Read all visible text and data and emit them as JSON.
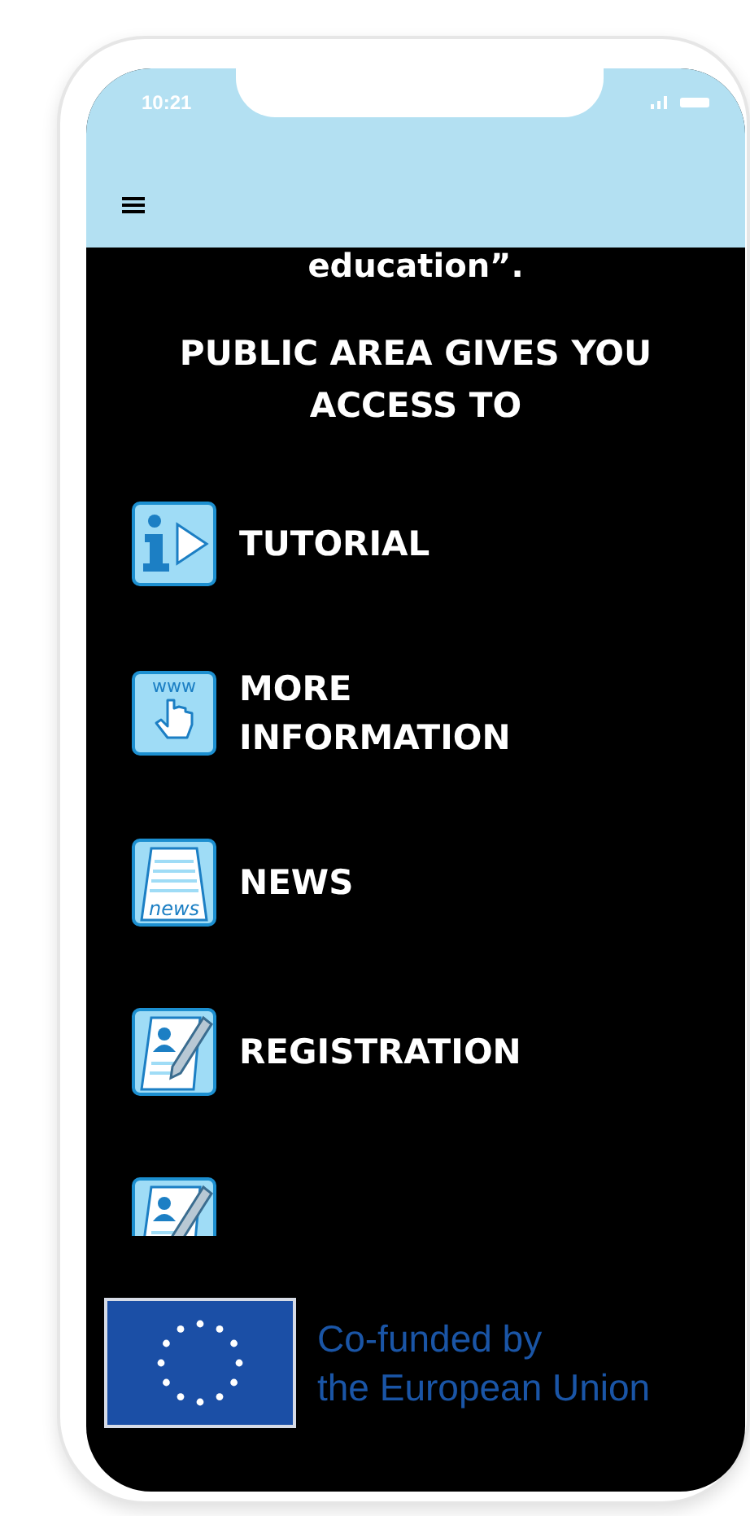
{
  "status_bar": {
    "time": "10:21"
  },
  "intro_text": "education”.",
  "heading": "PUBLIC AREA GIVES YOU ACCESS TO",
  "menu_items": [
    {
      "kind": "info",
      "label": "TUTORIAL"
    },
    {
      "kind": "web",
      "icon_text": "www",
      "label": "MORE INFORMATION"
    },
    {
      "kind": "news",
      "icon_text": "news",
      "label": "NEWS"
    },
    {
      "kind": "registration",
      "label": "REGISTRATION"
    },
    {
      "kind": "registration"
    }
  ],
  "footer": {
    "text": "Co-funded by\nthe European Union"
  }
}
